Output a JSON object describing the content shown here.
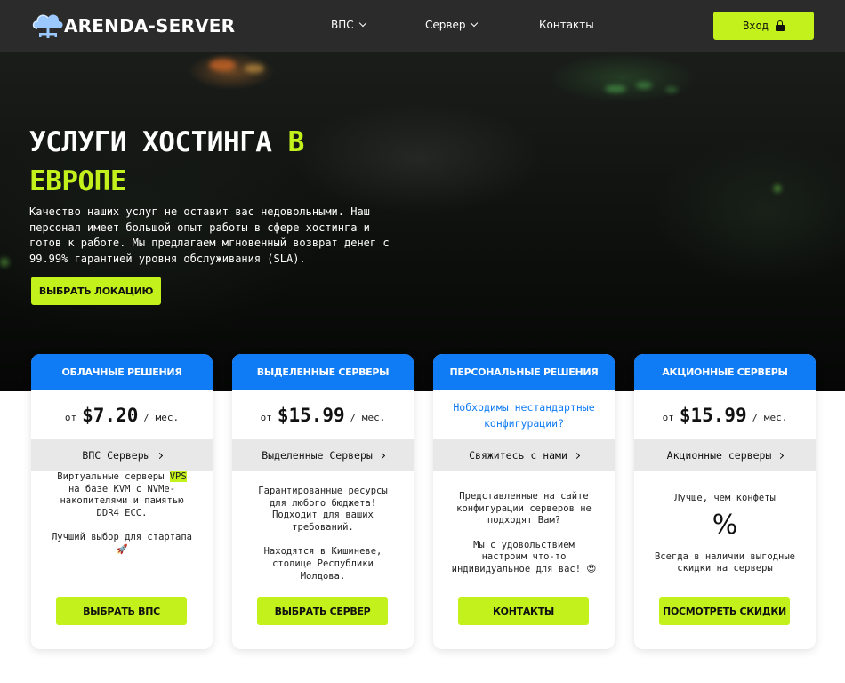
{
  "brand": {
    "name": "ARENDA-SERVER",
    "accent": "#c3f11b",
    "blue": "#0f7bf5"
  },
  "nav": {
    "items": [
      {
        "label": "ВПС",
        "dropdown": true
      },
      {
        "label": "Сервер",
        "dropdown": true
      },
      {
        "label": "Контакты",
        "dropdown": false
      }
    ],
    "login_label": "Вход",
    "login_icon": "lock-icon"
  },
  "hero": {
    "title_white": "УСЛУГИ ХОСТИНГА ",
    "title_accent_1": "В",
    "title_accent_2": "ЕВРОПЕ",
    "description": "Качество наших услуг не оставит вас недовольными. Наш персонал имеет большой опыт работы в сфере хостинга и готов к работе. Мы предлагаем мгновенный возврат денег с 99.99% гарантией уровня обслуживания (SLA).",
    "button_label": "ВЫБРАТЬ ЛОКАЦИЮ"
  },
  "cards": [
    {
      "header": "ОБЛАЧНЫЕ РЕШЕНИЯ",
      "price_from": "от",
      "price": "$7.20",
      "price_per": "/ мес.",
      "sub_link": "ВПС Серверы",
      "body_1_pre": "Виртуальные серверы ",
      "body_1_hl": "VPS",
      "body_1_post": " на базе KVM с NVMe-накопителями и памятью DDR4 ECC.",
      "body_2": "Лучший выбор для стартапа",
      "body_2_emoji": "🚀",
      "button": "ВЫБРАТЬ ВПС"
    },
    {
      "header": "ВЫДЕЛЕННЫЕ СЕРВЕРЫ",
      "price_from": "от",
      "price": "$15.99",
      "price_per": "/ мес.",
      "sub_link": "Выделенные Серверы",
      "body_1": "Гарантированные ресурсы для любого бюджета! Подходит для ваших требований.",
      "body_2": "Находятся в Кишиневе, столице Республики Молдова.",
      "button": "ВЫБРАТЬ СЕРВЕР"
    },
    {
      "header": "ПЕРСОНАЛЬНЫЕ РЕШЕНИЯ",
      "price_link": "Нобходимы нестандартные конфигурации?",
      "sub_link": "Свяжитесь с нами",
      "body_1": "Представленные на сайте конфигурации серверов не подходят Вам?",
      "body_2": "Мы с удовольствием настроим что-то индивидуальное для вас!",
      "body_2_emoji": "😍",
      "button": "КОНТАКТЫ"
    },
    {
      "header": "АКЦИОННЫЕ СЕРВЕРЫ",
      "price_from": "от",
      "price": "$15.99",
      "price_per": "/ мес.",
      "sub_link": "Акционные серверы",
      "body_1": "Лучше, чем конфеты",
      "body_symbol": "%",
      "body_2": "Всегда в наличии выгодные скидки на серверы",
      "button": "ПОСМОТРЕТЬ СКИДКИ"
    }
  ]
}
